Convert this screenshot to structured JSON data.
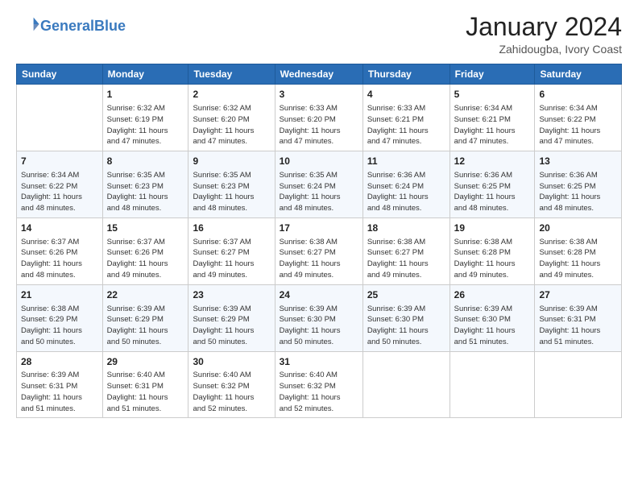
{
  "header": {
    "logo_line1": "General",
    "logo_line2": "Blue",
    "month": "January 2024",
    "location": "Zahidougba, Ivory Coast"
  },
  "days_of_week": [
    "Sunday",
    "Monday",
    "Tuesday",
    "Wednesday",
    "Thursday",
    "Friday",
    "Saturday"
  ],
  "weeks": [
    [
      {
        "day": "",
        "info": ""
      },
      {
        "day": "1",
        "info": "Sunrise: 6:32 AM\nSunset: 6:19 PM\nDaylight: 11 hours\nand 47 minutes."
      },
      {
        "day": "2",
        "info": "Sunrise: 6:32 AM\nSunset: 6:20 PM\nDaylight: 11 hours\nand 47 minutes."
      },
      {
        "day": "3",
        "info": "Sunrise: 6:33 AM\nSunset: 6:20 PM\nDaylight: 11 hours\nand 47 minutes."
      },
      {
        "day": "4",
        "info": "Sunrise: 6:33 AM\nSunset: 6:21 PM\nDaylight: 11 hours\nand 47 minutes."
      },
      {
        "day": "5",
        "info": "Sunrise: 6:34 AM\nSunset: 6:21 PM\nDaylight: 11 hours\nand 47 minutes."
      },
      {
        "day": "6",
        "info": "Sunrise: 6:34 AM\nSunset: 6:22 PM\nDaylight: 11 hours\nand 47 minutes."
      }
    ],
    [
      {
        "day": "7",
        "info": "Sunrise: 6:34 AM\nSunset: 6:22 PM\nDaylight: 11 hours\nand 48 minutes."
      },
      {
        "day": "8",
        "info": "Sunrise: 6:35 AM\nSunset: 6:23 PM\nDaylight: 11 hours\nand 48 minutes."
      },
      {
        "day": "9",
        "info": "Sunrise: 6:35 AM\nSunset: 6:23 PM\nDaylight: 11 hours\nand 48 minutes."
      },
      {
        "day": "10",
        "info": "Sunrise: 6:35 AM\nSunset: 6:24 PM\nDaylight: 11 hours\nand 48 minutes."
      },
      {
        "day": "11",
        "info": "Sunrise: 6:36 AM\nSunset: 6:24 PM\nDaylight: 11 hours\nand 48 minutes."
      },
      {
        "day": "12",
        "info": "Sunrise: 6:36 AM\nSunset: 6:25 PM\nDaylight: 11 hours\nand 48 minutes."
      },
      {
        "day": "13",
        "info": "Sunrise: 6:36 AM\nSunset: 6:25 PM\nDaylight: 11 hours\nand 48 minutes."
      }
    ],
    [
      {
        "day": "14",
        "info": "Sunrise: 6:37 AM\nSunset: 6:26 PM\nDaylight: 11 hours\nand 48 minutes."
      },
      {
        "day": "15",
        "info": "Sunrise: 6:37 AM\nSunset: 6:26 PM\nDaylight: 11 hours\nand 49 minutes."
      },
      {
        "day": "16",
        "info": "Sunrise: 6:37 AM\nSunset: 6:27 PM\nDaylight: 11 hours\nand 49 minutes."
      },
      {
        "day": "17",
        "info": "Sunrise: 6:38 AM\nSunset: 6:27 PM\nDaylight: 11 hours\nand 49 minutes."
      },
      {
        "day": "18",
        "info": "Sunrise: 6:38 AM\nSunset: 6:27 PM\nDaylight: 11 hours\nand 49 minutes."
      },
      {
        "day": "19",
        "info": "Sunrise: 6:38 AM\nSunset: 6:28 PM\nDaylight: 11 hours\nand 49 minutes."
      },
      {
        "day": "20",
        "info": "Sunrise: 6:38 AM\nSunset: 6:28 PM\nDaylight: 11 hours\nand 49 minutes."
      }
    ],
    [
      {
        "day": "21",
        "info": "Sunrise: 6:38 AM\nSunset: 6:29 PM\nDaylight: 11 hours\nand 50 minutes."
      },
      {
        "day": "22",
        "info": "Sunrise: 6:39 AM\nSunset: 6:29 PM\nDaylight: 11 hours\nand 50 minutes."
      },
      {
        "day": "23",
        "info": "Sunrise: 6:39 AM\nSunset: 6:29 PM\nDaylight: 11 hours\nand 50 minutes."
      },
      {
        "day": "24",
        "info": "Sunrise: 6:39 AM\nSunset: 6:30 PM\nDaylight: 11 hours\nand 50 minutes."
      },
      {
        "day": "25",
        "info": "Sunrise: 6:39 AM\nSunset: 6:30 PM\nDaylight: 11 hours\nand 50 minutes."
      },
      {
        "day": "26",
        "info": "Sunrise: 6:39 AM\nSunset: 6:30 PM\nDaylight: 11 hours\nand 51 minutes."
      },
      {
        "day": "27",
        "info": "Sunrise: 6:39 AM\nSunset: 6:31 PM\nDaylight: 11 hours\nand 51 minutes."
      }
    ],
    [
      {
        "day": "28",
        "info": "Sunrise: 6:39 AM\nSunset: 6:31 PM\nDaylight: 11 hours\nand 51 minutes."
      },
      {
        "day": "29",
        "info": "Sunrise: 6:40 AM\nSunset: 6:31 PM\nDaylight: 11 hours\nand 51 minutes."
      },
      {
        "day": "30",
        "info": "Sunrise: 6:40 AM\nSunset: 6:32 PM\nDaylight: 11 hours\nand 52 minutes."
      },
      {
        "day": "31",
        "info": "Sunrise: 6:40 AM\nSunset: 6:32 PM\nDaylight: 11 hours\nand 52 minutes."
      },
      {
        "day": "",
        "info": ""
      },
      {
        "day": "",
        "info": ""
      },
      {
        "day": "",
        "info": ""
      }
    ]
  ]
}
